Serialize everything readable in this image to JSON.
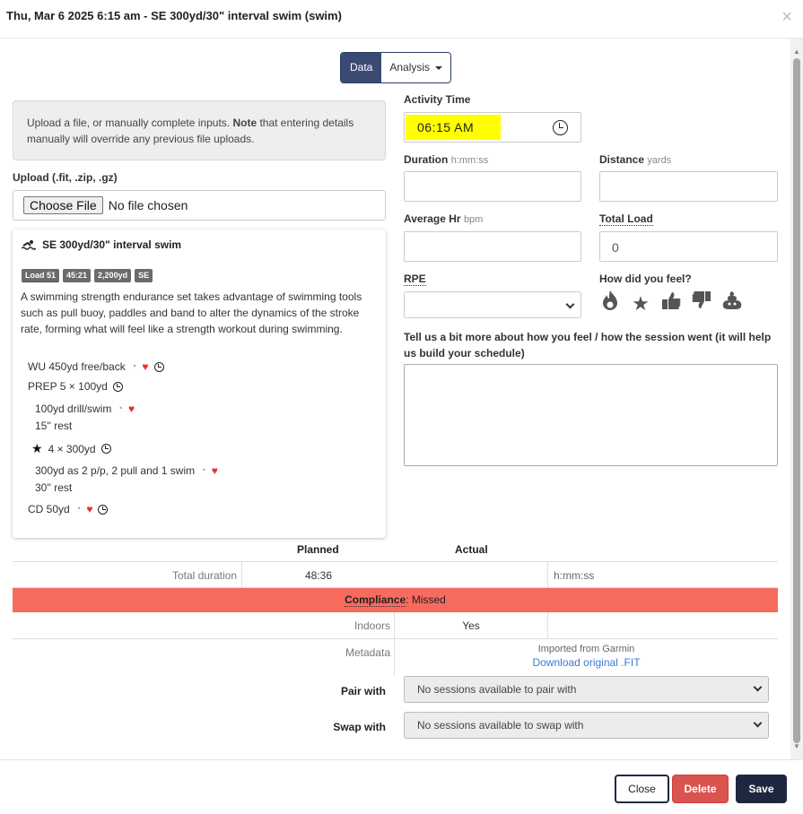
{
  "modal": {
    "title": "Thu, Mar 6 2025 6:15 am - SE 300yd/30\" interval swim (swim)",
    "close_glyph": "×"
  },
  "tabs": {
    "data": "Data",
    "analysis": "Analysis"
  },
  "info": {
    "text_before": "Upload a file, or manually complete inputs. ",
    "note": "Note",
    "text_after": " that entering details manually will override any previous file uploads."
  },
  "upload": {
    "label": "Upload (.fit, .zip, .gz)",
    "button": "Choose File",
    "status": "No file chosen"
  },
  "workout": {
    "title": "SE 300yd/30\" interval swim",
    "badges": [
      "Load 51",
      "45:21",
      "2,200yd",
      "SE"
    ],
    "description": "A swimming strength endurance set takes advantage of swimming tools such as pull buoy, paddles and band to alter the dynamics of the stroke rate, forming what will feel like a strength workout during swimming.",
    "steps": {
      "wu": "WU 450yd free/back",
      "prep": "PREP 5 × 100yd",
      "prep_item": "100yd drill/swim",
      "prep_rest": "15'' rest",
      "main": "4 × 300yd",
      "main_item": "300yd as 2 p/p, 2 pull and 1 swim",
      "main_rest": "30'' rest",
      "cd": "CD 50yd"
    }
  },
  "form": {
    "activity_time_label": "Activity Time",
    "activity_time_value": "06:15 AM",
    "duration_label": "Duration",
    "duration_unit": "h:mm:ss",
    "distance_label": "Distance",
    "distance_unit": "yards",
    "avg_hr_label": "Average Hr",
    "avg_hr_unit": "bpm",
    "total_load_label": "Total Load",
    "total_load_value": "0",
    "rpe_label": "RPE",
    "feel_label": "How did you feel?",
    "feel_icons": [
      "fire-icon",
      "star-icon",
      "thumbs-up-icon",
      "thumbs-down-icon",
      "poop-icon"
    ],
    "notes_label": "Tell us a bit more about how you feel / how the session went (it will help us build your schedule)"
  },
  "comparison": {
    "planned_header": "Planned",
    "actual_header": "Actual",
    "total_duration_label": "Total duration",
    "total_duration_planned": "48:36",
    "total_duration_actual_placeholder": "h:mm:ss",
    "compliance_label": "Compliance",
    "compliance_value": ": Missed",
    "indoors_label": "Indoors",
    "indoors_value": "Yes",
    "metadata_label": "Metadata",
    "metadata_source": "Imported from Garmin",
    "metadata_link": "Download original .FIT"
  },
  "pair": {
    "pair_label": "Pair with",
    "pair_value": "No sessions available to pair with",
    "swap_label": "Swap with",
    "swap_value": "No sessions available to swap with"
  },
  "footer": {
    "close": "Close",
    "delete": "Delete",
    "save": "Save"
  },
  "colors": {
    "primary": "#3b4a73",
    "compliance_missed": "#f76b5f",
    "delete": "#d9534f",
    "save": "#1f2640",
    "highlight": "#ffff00"
  }
}
